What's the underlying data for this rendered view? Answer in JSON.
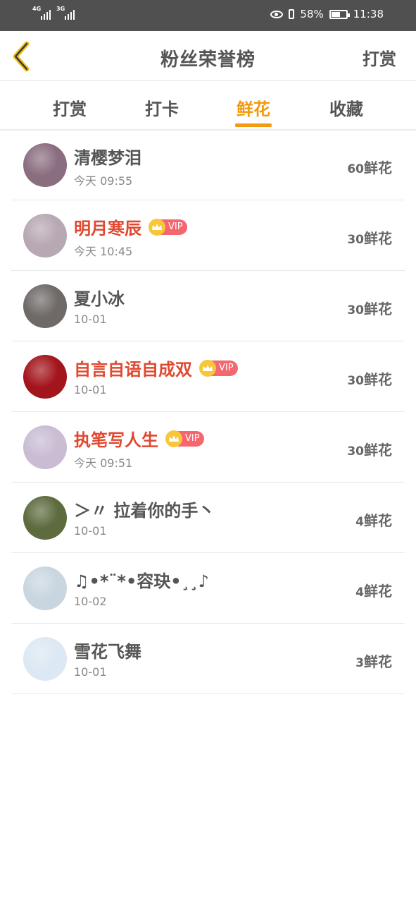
{
  "status_bar": {
    "net1": "4G",
    "net2": "3G",
    "battery_percent": "58%",
    "battery_level": 0.58,
    "time": "11:38"
  },
  "header": {
    "title": "粉丝荣誉榜",
    "action": "打赏"
  },
  "tabs": [
    {
      "label": "打赏",
      "active": false
    },
    {
      "label": "打卡",
      "active": false
    },
    {
      "label": "鲜花",
      "active": true
    },
    {
      "label": "收藏",
      "active": false
    }
  ],
  "unit": "鲜花",
  "vip_label": "VIP",
  "fans": [
    {
      "name": "清樱梦泪",
      "vip": false,
      "date": "今天 09:55",
      "count": "60",
      "avatar_color": "#8a6e80"
    },
    {
      "name": "明月寒辰",
      "vip": true,
      "date": "今天 10:45",
      "count": "30",
      "avatar_color": "#b7a8b4"
    },
    {
      "name": "夏小冰",
      "vip": false,
      "date": "10-01",
      "count": "30",
      "avatar_color": "#6f6a68"
    },
    {
      "name": "自言自语自成双",
      "vip": true,
      "date": "10-01",
      "count": "30",
      "avatar_color": "#a3151c"
    },
    {
      "name": "执笔写人生",
      "vip": true,
      "date": "今天 09:51",
      "count": "30",
      "avatar_color": "#c9bcd3"
    },
    {
      "name": "＞〃 拉着你的手丶",
      "vip": false,
      "date": "10-01",
      "count": "4",
      "avatar_color": "#5d6b3e"
    },
    {
      "name": "♫•*¨*•容玦•¸¸♪",
      "vip": false,
      "date": "10-02",
      "count": "4",
      "avatar_color": "#c9d6df"
    },
    {
      "name": "雪花飞舞",
      "vip": false,
      "date": "10-01",
      "count": "3",
      "avatar_color": "#dce8f3"
    }
  ]
}
